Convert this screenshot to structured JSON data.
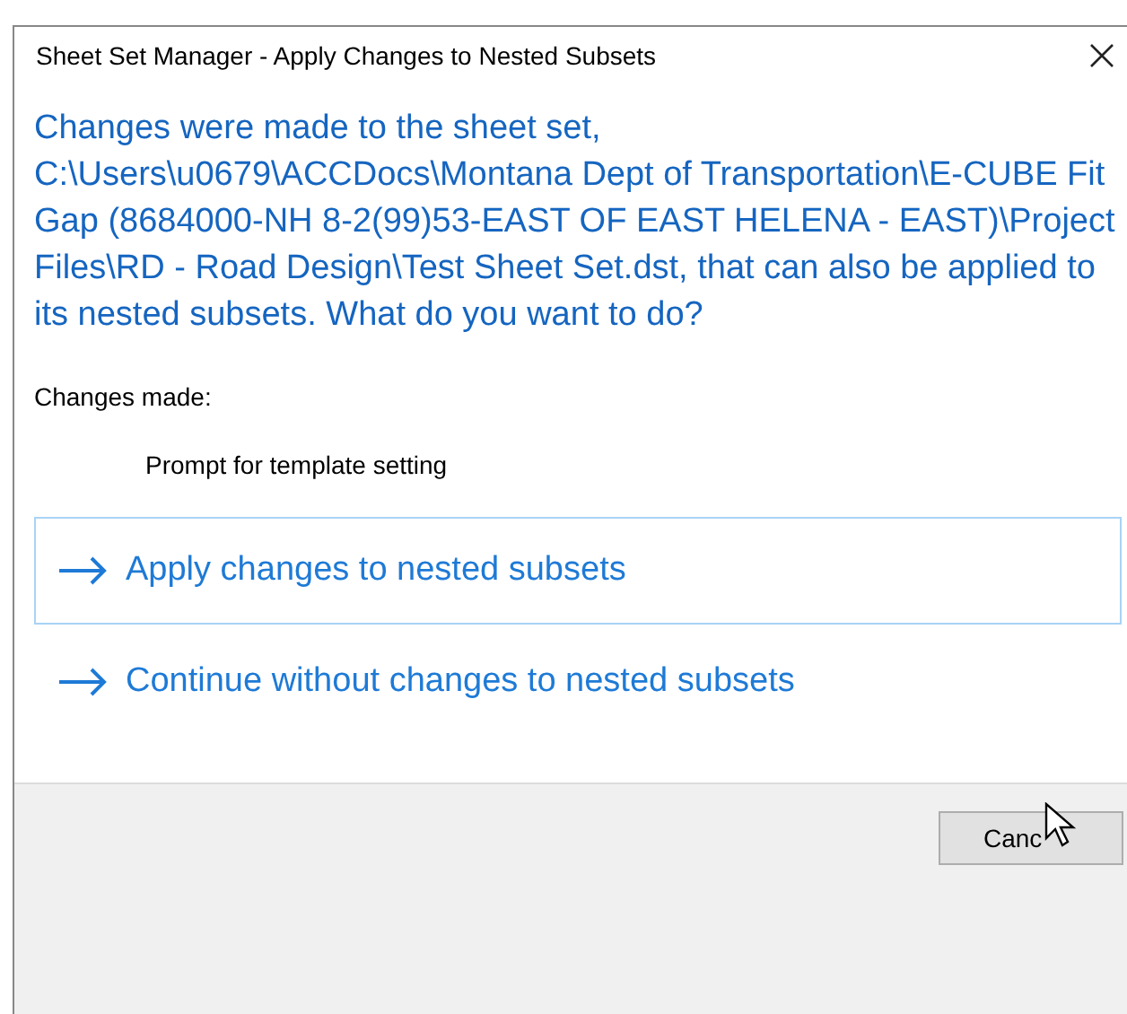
{
  "window": {
    "title": "Sheet Set Manager - Apply Changes to Nested Subsets"
  },
  "message": "Changes were made to the sheet set, C:\\Users\\u0679\\ACCDocs\\Montana Dept of Transportation\\E-CUBE Fit Gap (8684000-NH 8-2(99)53-EAST OF EAST HELENA - EAST)\\Project Files\\RD - Road Design\\Test Sheet Set.dst, that can also be applied to its nested subsets. What do you want to do?",
  "changes_label": "Changes made:",
  "changes": [
    "Prompt for template setting"
  ],
  "options": [
    {
      "label": "Apply changes to nested subsets",
      "selected": true
    },
    {
      "label": "Continue without changes to nested subsets",
      "selected": false
    }
  ],
  "buttons": [
    {
      "label": "Canc"
    }
  ]
}
